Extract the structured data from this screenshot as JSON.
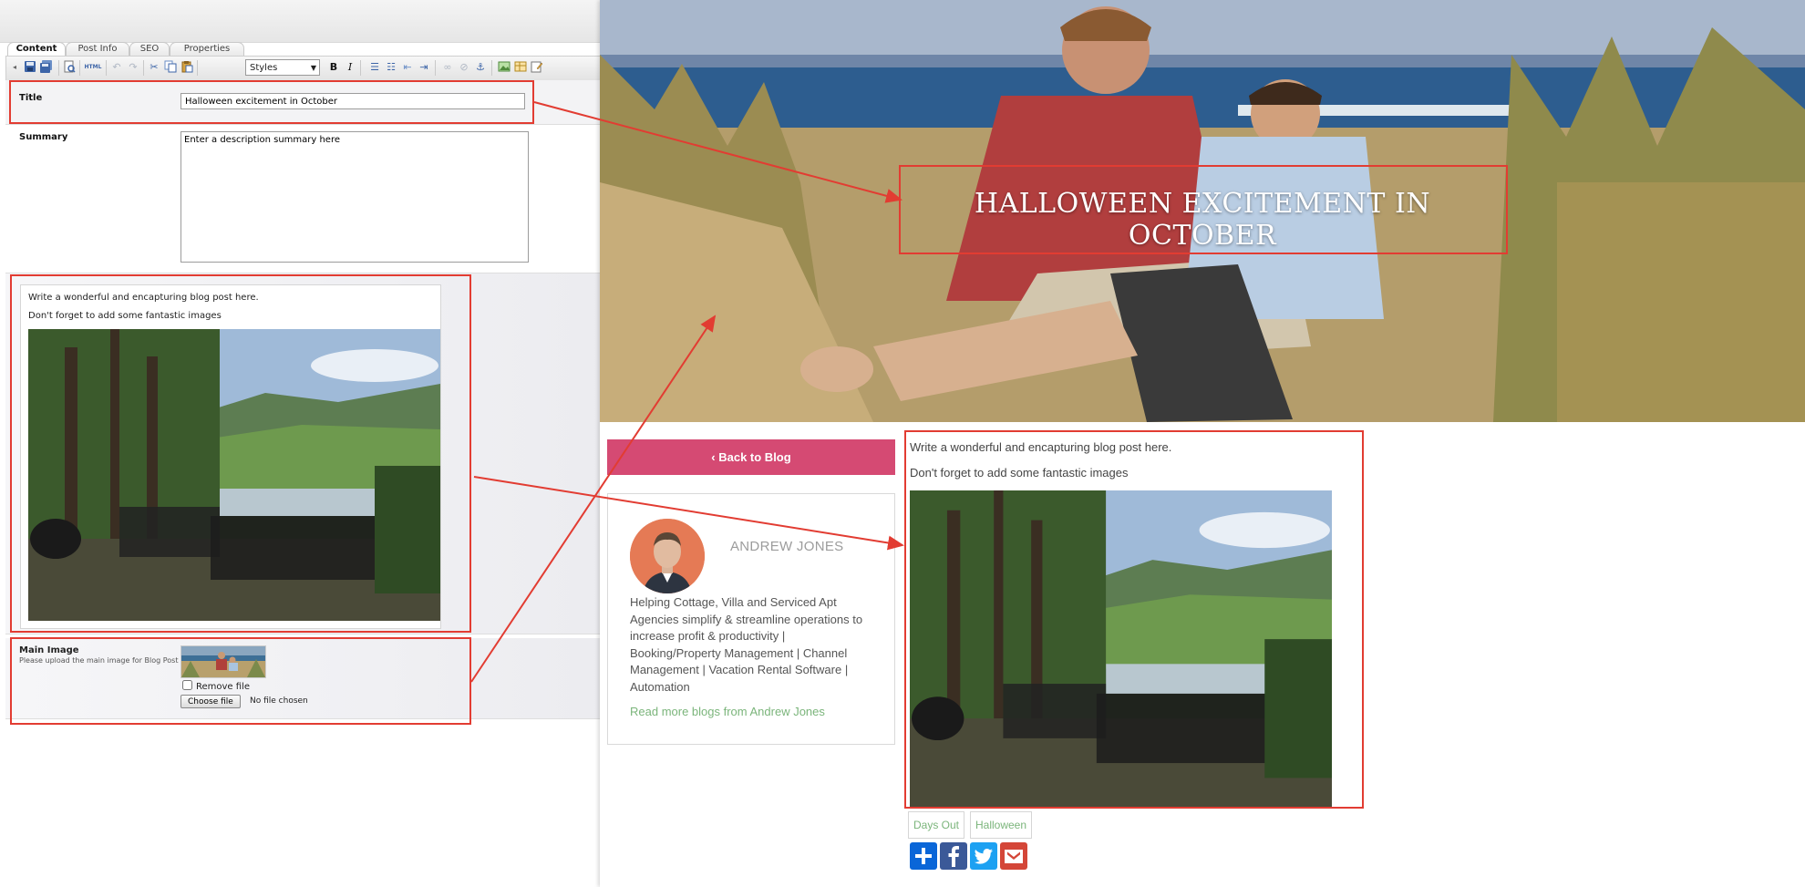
{
  "cms": {
    "tabs": [
      {
        "label": "Content"
      },
      {
        "label": "Post Info"
      },
      {
        "label": "SEO"
      },
      {
        "label": "Properties"
      }
    ],
    "toolbar": {
      "styles_select_value": "Styles",
      "html_label": "HTML",
      "bold_label": "B",
      "italic_label": "I"
    },
    "title_field": {
      "label": "Title",
      "value": "Halloween excitement in October"
    },
    "summary_field": {
      "label": "Summary",
      "value": "Enter a description summary here"
    },
    "editor": {
      "paragraphs": [
        "Write a wonderful and encapturing blog post here.",
        "Don't forget to add some fantastic images"
      ]
    },
    "main_image": {
      "label": "Main Image",
      "help": "Please upload the main image for Blog Post",
      "remove_label": "Remove file",
      "choose_label": "Choose file",
      "no_file_label": "No file chosen"
    }
  },
  "preview": {
    "hero_title": "HALLOWEEN EXCITEMENT IN OCTOBER",
    "back_button": "Back to Blog",
    "author": {
      "name": "ANDREW JONES",
      "bio": "Helping Cottage, Villa and Serviced Apt Agencies simplify & streamline operations to increase profit & productivity | Booking/Property Management | Channel Management | Vacation Rental Software | Automation",
      "link": "Read more blogs from Andrew Jones"
    },
    "post": {
      "paragraphs": [
        "Write a wonderful and encapturing blog post here.",
        "Don't forget to add some fantastic images"
      ]
    },
    "tags": [
      "Days Out",
      "Halloween"
    ],
    "share_buttons": [
      {
        "icon": "plus-icon",
        "color": "#0a66d8"
      },
      {
        "icon": "facebook-icon",
        "color": "#3b5998"
      },
      {
        "icon": "twitter-icon",
        "color": "#1da1f2"
      },
      {
        "icon": "gmail-icon",
        "color": "#d44638"
      }
    ]
  },
  "colors": {
    "annotation": "#e23c32",
    "accent_pink": "#d54a73",
    "link_green": "#7bb57b"
  }
}
